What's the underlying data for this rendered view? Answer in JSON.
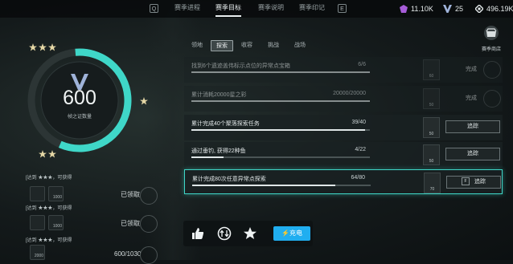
{
  "topbar": {
    "left_key": "Q",
    "right_key": "E",
    "tabs": [
      {
        "label": "赛季进程",
        "active": false
      },
      {
        "label": "赛季目标",
        "active": true
      },
      {
        "label": "赛季说明",
        "active": false
      },
      {
        "label": "赛季印记",
        "active": false
      }
    ],
    "resources": [
      {
        "icon": "purple-gem-icon",
        "value": "11.10K"
      },
      {
        "icon": "season-mark-icon",
        "value": "25"
      },
      {
        "icon": "diamond-currency-icon",
        "value": "496.19K"
      }
    ]
  },
  "shop": {
    "label": "赛季商店",
    "icon": "shop-icon"
  },
  "progress_ring": {
    "value": "600",
    "label": "帧之证数量",
    "fill_fraction": 0.58,
    "accent": "#3fd7c8"
  },
  "reward_tiers": [
    {
      "stars": 3,
      "text": "[达到",
      "suffix": "，可获得",
      "items": [
        "",
        "1000"
      ],
      "status": "已领取"
    },
    {
      "stars": 3,
      "text": "[达到",
      "suffix": "，可获得",
      "items": [
        "",
        "1000"
      ],
      "status": "已领取"
    },
    {
      "stars": 3,
      "text": "[达到",
      "suffix": "，可获得",
      "items": [
        "2000"
      ],
      "status": "600/1030"
    }
  ],
  "task_tabs": [
    {
      "label": "领地",
      "active": false
    },
    {
      "label": "探索",
      "active": true
    },
    {
      "label": "收容",
      "active": false
    },
    {
      "label": "挑战",
      "active": false
    },
    {
      "label": "战场",
      "active": false
    }
  ],
  "tasks": [
    {
      "title": "找到6个遗迹盖伟标示点位的异常点宝箱",
      "progress": "6/6",
      "fraction": 1.0,
      "reward": "60",
      "state": "完成",
      "action": "",
      "dim": true,
      "highlight": false
    },
    {
      "title": "累计消耗20000星之彩",
      "progress": "20000/20000",
      "fraction": 1.0,
      "reward": "50",
      "state": "完成",
      "action": "",
      "dim": true,
      "highlight": false
    },
    {
      "title": "累计完成40个聚落探索任务",
      "progress": "39/40",
      "fraction": 0.975,
      "reward": "50",
      "state": "",
      "action": "追踪",
      "dim": false,
      "highlight": false
    },
    {
      "title": "通过垂钓, 获得22种鱼",
      "progress": "4/22",
      "fraction": 0.18,
      "reward": "50",
      "state": "",
      "action": "追踪",
      "dim": false,
      "highlight": false
    },
    {
      "title": "累计完成80次任意异常点探索",
      "progress": "64/80",
      "fraction": 0.8,
      "reward": "70",
      "state": "",
      "action": "追踪",
      "action_key": "F",
      "dim": false,
      "highlight": true
    }
  ],
  "bottom_bar": {
    "icons": [
      "thumbs-up-icon",
      "swap-icon",
      "star-icon"
    ],
    "charge_label": "充电",
    "charge_color": "#20aef0"
  }
}
